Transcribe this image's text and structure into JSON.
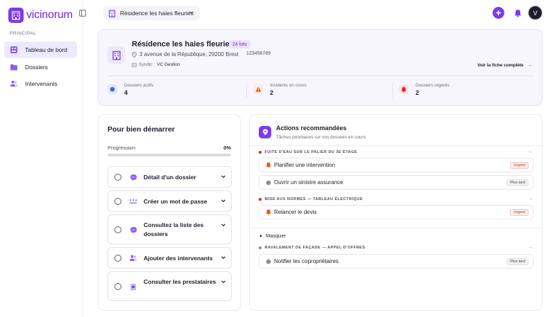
{
  "app": {
    "name": "vicinorum"
  },
  "sidebar": {
    "section_label": "Principal",
    "items": [
      {
        "label": "Tableau de bord",
        "icon": "dashboard-icon",
        "active": true
      },
      {
        "label": "Dossiers",
        "icon": "folder-icon",
        "active": false
      },
      {
        "label": "Intervenants",
        "icon": "users-icon",
        "active": false
      }
    ]
  },
  "topbar": {
    "residence_selector": "Résidence les haies fleuries",
    "avatar_initial": "V"
  },
  "residence": {
    "name": "Résidence les haies fleuries",
    "lots_badge": "24 lots",
    "address": "3 avenue de la République, 29200 Brest",
    "number": "123456789",
    "syndic_label": "Syndic :",
    "syndic_value": "VC Gestion",
    "link_label": "Voir la fiche complète",
    "stats": [
      {
        "label": "Dossiers actifs",
        "value": "4",
        "icon": "chat-icon",
        "color": "#6d28d9"
      },
      {
        "label": "Incidents en cours",
        "value": "2",
        "icon": "warning-icon",
        "color": "#ea580c"
      },
      {
        "label": "Dossiers urgents",
        "value": "2",
        "icon": "bell-icon",
        "color": "#dc2626"
      }
    ]
  },
  "getting_started": {
    "title": "Pour bien démarrer",
    "progress_label": "Progression",
    "progress_value": "0%",
    "progress_fraction": 0,
    "tasks": [
      {
        "label": "Détail d'un dossier",
        "icon": "chat-bubble-icon"
      },
      {
        "label": "Créer un mot de passe",
        "icon": "password-icon"
      },
      {
        "label": "Consultez la liste des dossiers",
        "icon": "chat-bubble-icon"
      },
      {
        "label": "Ajouter des intervenants",
        "icon": "users-icon"
      },
      {
        "label": "Consulter les prestataires",
        "icon": "badge-icon"
      }
    ]
  },
  "actions": {
    "title": "Actions recommandées",
    "subtitle": "Tâches prioritaires sur vos dossiers en cours",
    "hide_label": "Masquer",
    "groups": [
      {
        "title": "FUITE D'EAU SUR LE PALIER DU 3E ÉTAGE",
        "dot_color": "#dc2626",
        "rows": [
          {
            "label": "Planifier une intervention",
            "tag": "Urgent",
            "kind": "urgent"
          },
          {
            "label": "Ouvrir un sinistre assurance",
            "tag": "Plus tard",
            "kind": "later"
          }
        ]
      },
      {
        "title": "MISE AUX NORMES — TABLEAU ÉLECTRIQUE",
        "dot_color": "#dc2626",
        "rows": [
          {
            "label": "Relancer le devis",
            "tag": "Urgent",
            "kind": "urgent"
          }
        ]
      },
      {
        "title": "RAVALEMENT DE FAÇADE — APPEL D'OFFRES",
        "dot_color": "#8a8a98",
        "rows": [
          {
            "label": "Notifier les copropriétaires",
            "tag": "Plus tard",
            "kind": "later"
          }
        ]
      }
    ]
  },
  "colors": {
    "accent": "#7c3aed",
    "accent_light": "#ede9fe",
    "urgent": "#dc2626",
    "warning": "#ea580c"
  }
}
